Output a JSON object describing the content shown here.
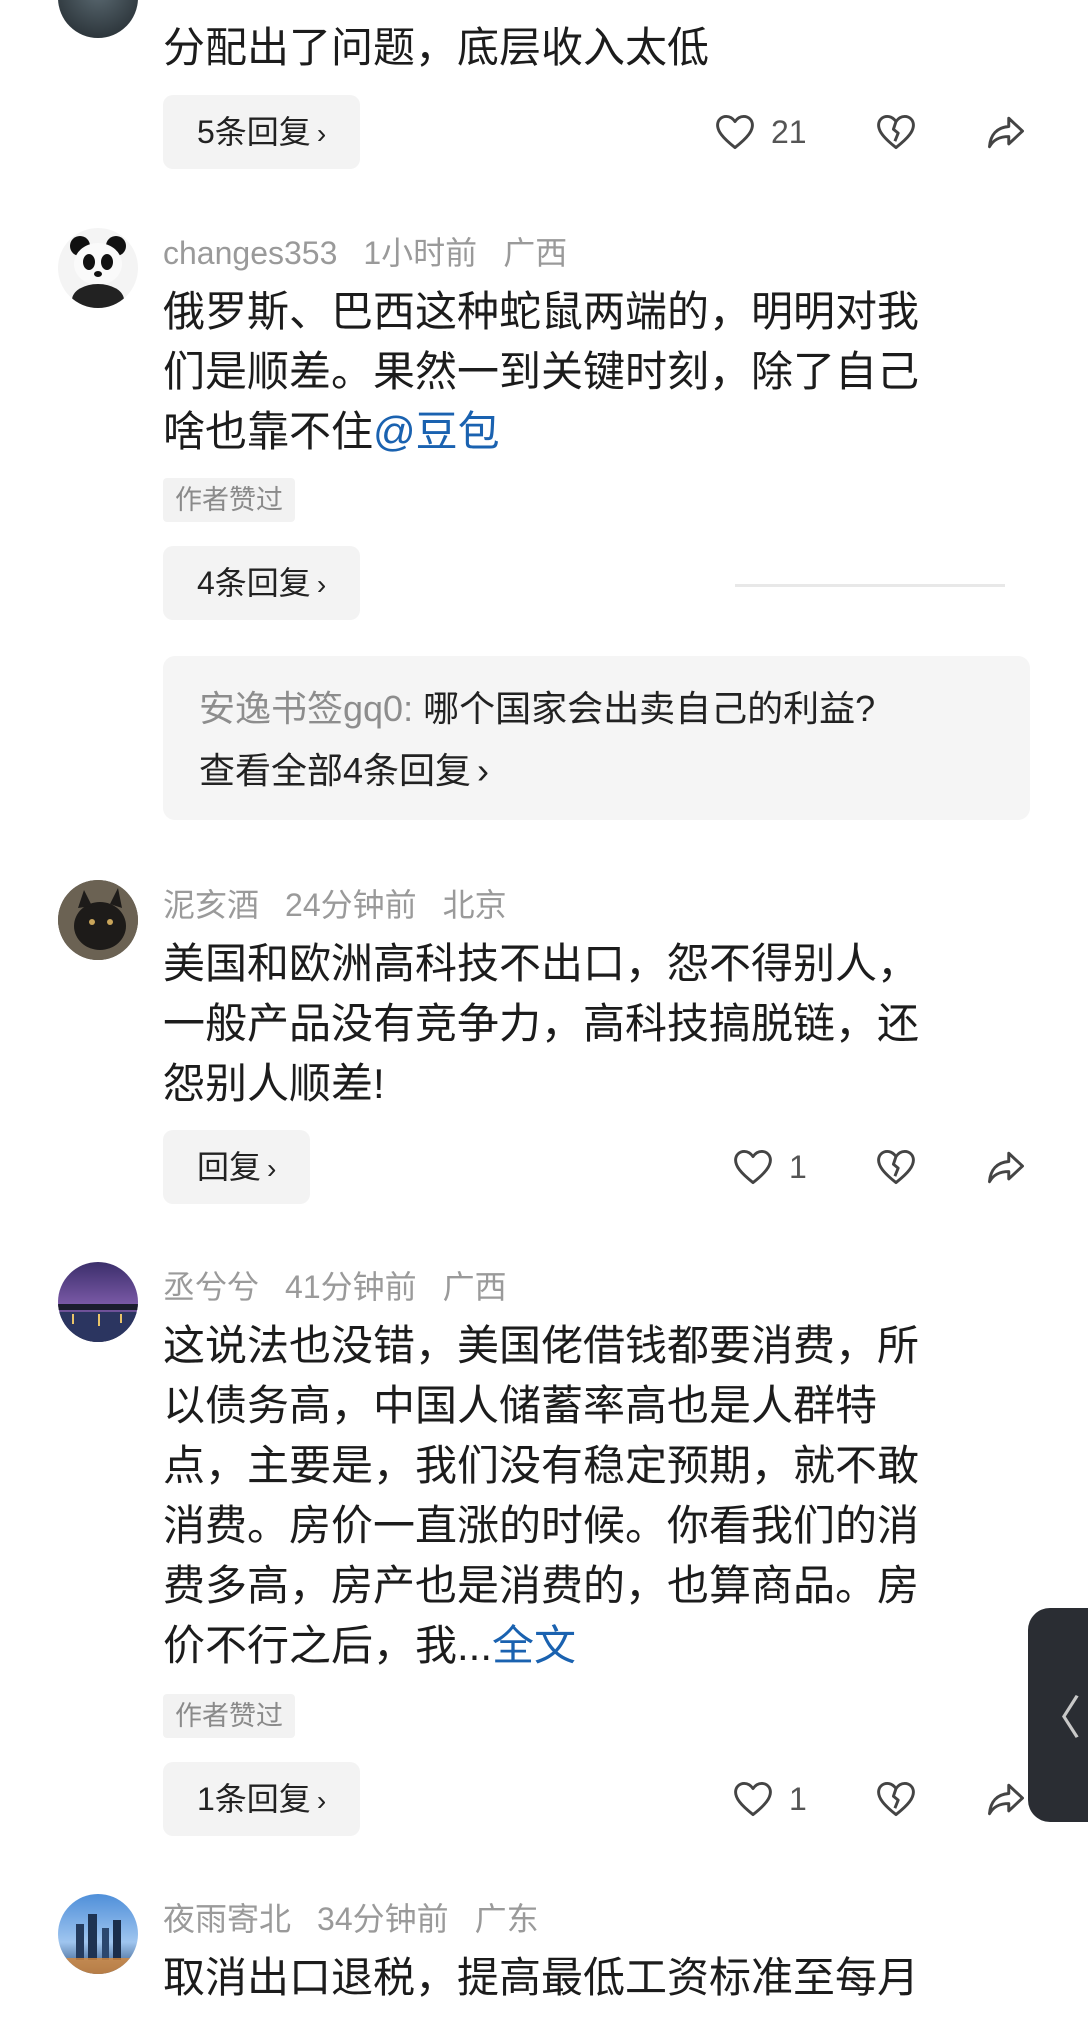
{
  "comments": [
    {
      "text_lines": [
        "分配出了问题，底层收入太低"
      ],
      "reply_label": "5条回复",
      "like_count": "21"
    },
    {
      "username": "changes353",
      "time": "1小时前",
      "location": "广西",
      "text_lines": [
        "俄罗斯、巴西这种蛇鼠两端的，明明对我",
        "们是顺差。果然一到关键时刻，除了自己",
        "啥也靠不住"
      ],
      "mention": "@豆包",
      "badge": "作者赞过",
      "reply_label": "4条回复",
      "quote": {
        "name": "安逸书签gq0:",
        "text": " 哪个国家会出卖自己的利益?",
        "view_all": "查看全部4条回复"
      }
    },
    {
      "username": "泥亥酒",
      "time": "24分钟前",
      "location": "北京",
      "text_lines": [
        "美国和欧洲高科技不出口，怨不得别人，",
        "一般产品没有竞争力，高科技搞脱链，还",
        "怨别人顺差!"
      ],
      "reply_label": "回复",
      "like_count": "1"
    },
    {
      "username": "丞兮兮",
      "time": "41分钟前",
      "location": "广西",
      "text_lines": [
        "这说法也没错，美国佬借钱都要消费，所",
        "以债务高，中国人储蓄率高也是人群特",
        "点，主要是，我们没有稳定预期，就不敢",
        "消费。房价一直涨的时候。你看我们的消",
        "费多高，房产也是消费的，也算商品。房",
        "价不行之后，我..."
      ],
      "fulltext": "全文",
      "badge": "作者赞过",
      "reply_label": "1条回复",
      "like_count": "1"
    },
    {
      "username": "夜雨寄北",
      "time": "34分钟前",
      "location": "广东",
      "text_lines": [
        "取消出口退税，提高最低工资标准至每月"
      ]
    }
  ],
  "chevron": "›",
  "side_tab_glyph": "〈",
  "colors": {
    "link": "#1a62b0",
    "meta": "#9a9a9a",
    "chip_bg": "#f3f3f3"
  },
  "icons": [
    "heart-icon",
    "broken-heart-icon",
    "share-icon"
  ]
}
